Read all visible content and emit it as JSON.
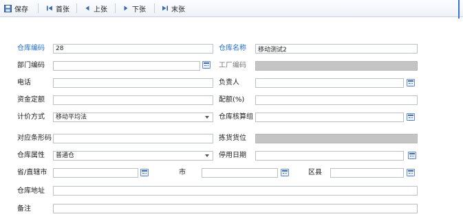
{
  "toolbar": {
    "save": "保存",
    "first": "首张",
    "prev": "上张",
    "next": "下张",
    "last": "末张"
  },
  "form": {
    "warehouse_code_label": "仓库编码",
    "warehouse_code_value": "28",
    "warehouse_name_label": "仓库名称",
    "warehouse_name_value": "移动测试2",
    "dept_code_label": "部门编码",
    "dept_code_value": "",
    "factory_code_label": "工厂编码",
    "phone_label": "电话",
    "phone_value": "",
    "manager_label": "负责人",
    "manager_value": "",
    "quota_label": "资金定额",
    "quota_value": "",
    "ratio_label": "配额(%)",
    "ratio_value": "",
    "pricing_label": "计价方式",
    "pricing_value": "移动平均法",
    "accounting_group_label": "仓库核算组",
    "accounting_group_value": "",
    "barcode_label": "对应条形码",
    "barcode_value": "",
    "pick_location_label": "拣货货位",
    "attribute_label": "仓库属性",
    "attribute_value": "普通仓",
    "disable_date_label": "停用日期",
    "disable_date_value": "",
    "province_label": "省/直辖市",
    "province_value": "",
    "city_label": "市",
    "city_value": "",
    "district_label": "区县",
    "district_value": "",
    "address_label": "仓库地址",
    "address_value": "",
    "remark_label": "备注",
    "remark_value": ""
  },
  "colors": {
    "accent": "#1f6fd1",
    "disabled_field": "#c4c4c4"
  },
  "icons": [
    "save-icon",
    "first-icon",
    "prev-icon",
    "next-icon",
    "last-icon",
    "calendar-icon",
    "lookup-icon",
    "dropdown-icon"
  ]
}
